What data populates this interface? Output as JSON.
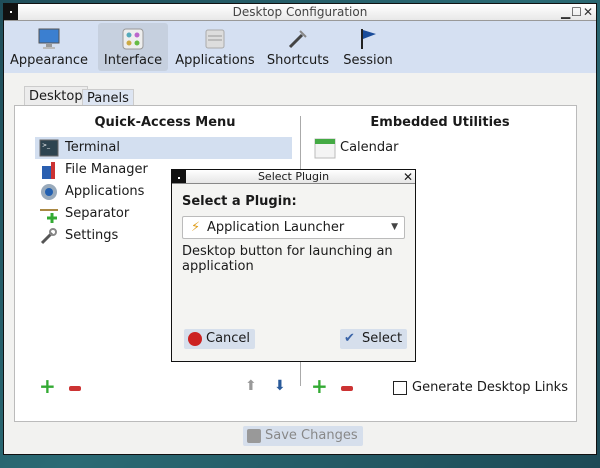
{
  "window": {
    "title": "Desktop Configuration"
  },
  "toolbar": [
    {
      "label": "Appearance",
      "icon": "monitor-icon"
    },
    {
      "label": "Interface",
      "icon": "interface-icon",
      "active": true
    },
    {
      "label": "Applications",
      "icon": "applications-icon"
    },
    {
      "label": "Shortcuts",
      "icon": "tools-icon"
    },
    {
      "label": "Session",
      "icon": "flag-icon"
    }
  ],
  "tabs": [
    {
      "label": "Desktop",
      "selected": true
    },
    {
      "label": "Panels"
    }
  ],
  "quick_access": {
    "heading": "Quick-Access Menu",
    "items": [
      "Terminal",
      "File Manager",
      "Applications",
      "Separator",
      "Settings"
    ],
    "selected": "Terminal"
  },
  "embedded": {
    "heading": "Embedded Utilities",
    "items": [
      "Calendar"
    ]
  },
  "generate_links": {
    "label": "Generate Desktop Links",
    "checked": false
  },
  "save_label": "Save Changes",
  "dialog": {
    "title": "Select Plugin",
    "prompt": "Select a Plugin:",
    "selected_plugin": "Application Launcher",
    "description": "Desktop button for launching an application",
    "cancel": "Cancel",
    "select": "Select"
  }
}
